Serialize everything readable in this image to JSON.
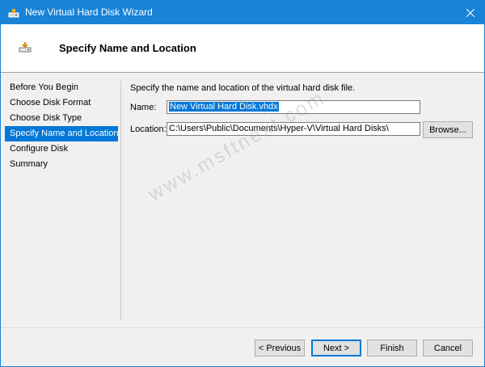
{
  "window": {
    "title": "New Virtual Hard Disk Wizard",
    "accent": "#1883d7"
  },
  "header": {
    "title": "Specify Name and Location"
  },
  "nav": {
    "items": [
      {
        "label": "Before You Begin"
      },
      {
        "label": "Choose Disk Format"
      },
      {
        "label": "Choose Disk Type"
      },
      {
        "label": "Specify Name and Location",
        "active": true
      },
      {
        "label": "Configure Disk"
      },
      {
        "label": "Summary"
      }
    ]
  },
  "content": {
    "intro": "Specify the name and location of the virtual hard disk file.",
    "name_label": "Name:",
    "name_value": "New Virtual Hard Disk.vhdx",
    "location_label": "Location:",
    "location_value": "C:\\Users\\Public\\Documents\\Hyper-V\\Virtual Hard Disks\\",
    "browse_label": "Browse..."
  },
  "footer": {
    "previous_label": "< Previous",
    "next_label": "Next >",
    "finish_label": "Finish",
    "cancel_label": "Cancel"
  },
  "watermark": "www.msftnext.com",
  "icons": {
    "app": "hard-disk-icon",
    "wizard": "hard-disk-icon",
    "close": "close-icon"
  }
}
